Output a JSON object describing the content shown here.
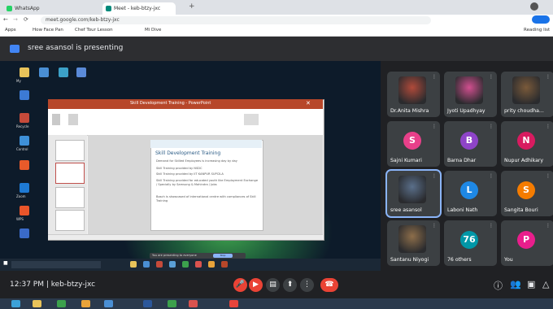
{
  "browser": {
    "tabs": [
      {
        "label": "WhatsApp",
        "color": "#25d366"
      },
      {
        "label": "Meet - keb-btzy-jxc",
        "color": "#00897b"
      }
    ],
    "url": "meet.google.com/keb-btzy-jxc",
    "bookmarks": [
      "Apps",
      "How Face Pan",
      "Chef Tour Lesson",
      "Mi Dive"
    ],
    "right_bookmark": "Reading list"
  },
  "meet": {
    "presenting_text": "sree asansol is presenting",
    "meeting_info": "12:37 PM  |  keb-btzy-jxc",
    "share_notice": "You are presenting to everyone",
    "stop_presenting": "Stop",
    "desktop_labels": [
      "My",
      "Recycle",
      "Control",
      "Zoom",
      "WPS"
    ]
  },
  "slide": {
    "window_title": "Skill Development Training - PowerPoint",
    "title": "Skill Development Training",
    "bullets": [
      "Demand for Skilled Employees is increasing day by day",
      "Skill Training provided by NSDC",
      "Skill Training provided by IIT KANPUR SUPCILA",
      "Skill Training provided for educated youth like Employment Exchange / Specially by Samsung & Mahindra / Jobs",
      "Bosch is showcased of international centre with compliances of Skill Training"
    ]
  },
  "participants": [
    {
      "name": "Dr.Anita Mishra",
      "type": "photo",
      "color": "#b04a3a"
    },
    {
      "name": "Jyoti Upadhyay",
      "type": "photo",
      "color": "#d14f8f"
    },
    {
      "name": "prity choudha...",
      "type": "photo",
      "color": "#7a5a3a"
    },
    {
      "name": "Sajni Kumari",
      "initial": "S",
      "color": "#e8408a"
    },
    {
      "name": "Barna Dhar",
      "initial": "B",
      "color": "#8e44c8"
    },
    {
      "name": "Nupur Adhikary",
      "initial": "N",
      "color": "#d81b60"
    },
    {
      "name": "sree asansol",
      "type": "photo",
      "color": "#5a6f8a"
    },
    {
      "name": "Laboni Nath",
      "initial": "L",
      "color": "#1e88e5"
    },
    {
      "name": "Sangita Bouri",
      "initial": "S",
      "color": "#f57c00"
    },
    {
      "name": "Santanu Niyogi",
      "type": "photo",
      "color": "#8d6e4a"
    },
    {
      "name": "76 others",
      "initial": "76",
      "color": "#0097a7"
    },
    {
      "name": "You",
      "initial": "P",
      "color": "#e91e8c"
    }
  ],
  "controls": [
    {
      "icon": "mic-off-icon",
      "color": "#ea4335"
    },
    {
      "icon": "camera-off-icon",
      "color": "#ea4335"
    },
    {
      "icon": "captions-icon",
      "color": "#3c4043"
    },
    {
      "icon": "present-icon",
      "color": "#3c4043"
    },
    {
      "icon": "more-icon",
      "color": "#3c4043"
    },
    {
      "icon": "hangup-icon",
      "color": "#ea4335"
    }
  ],
  "accent": "#8ab4f8"
}
